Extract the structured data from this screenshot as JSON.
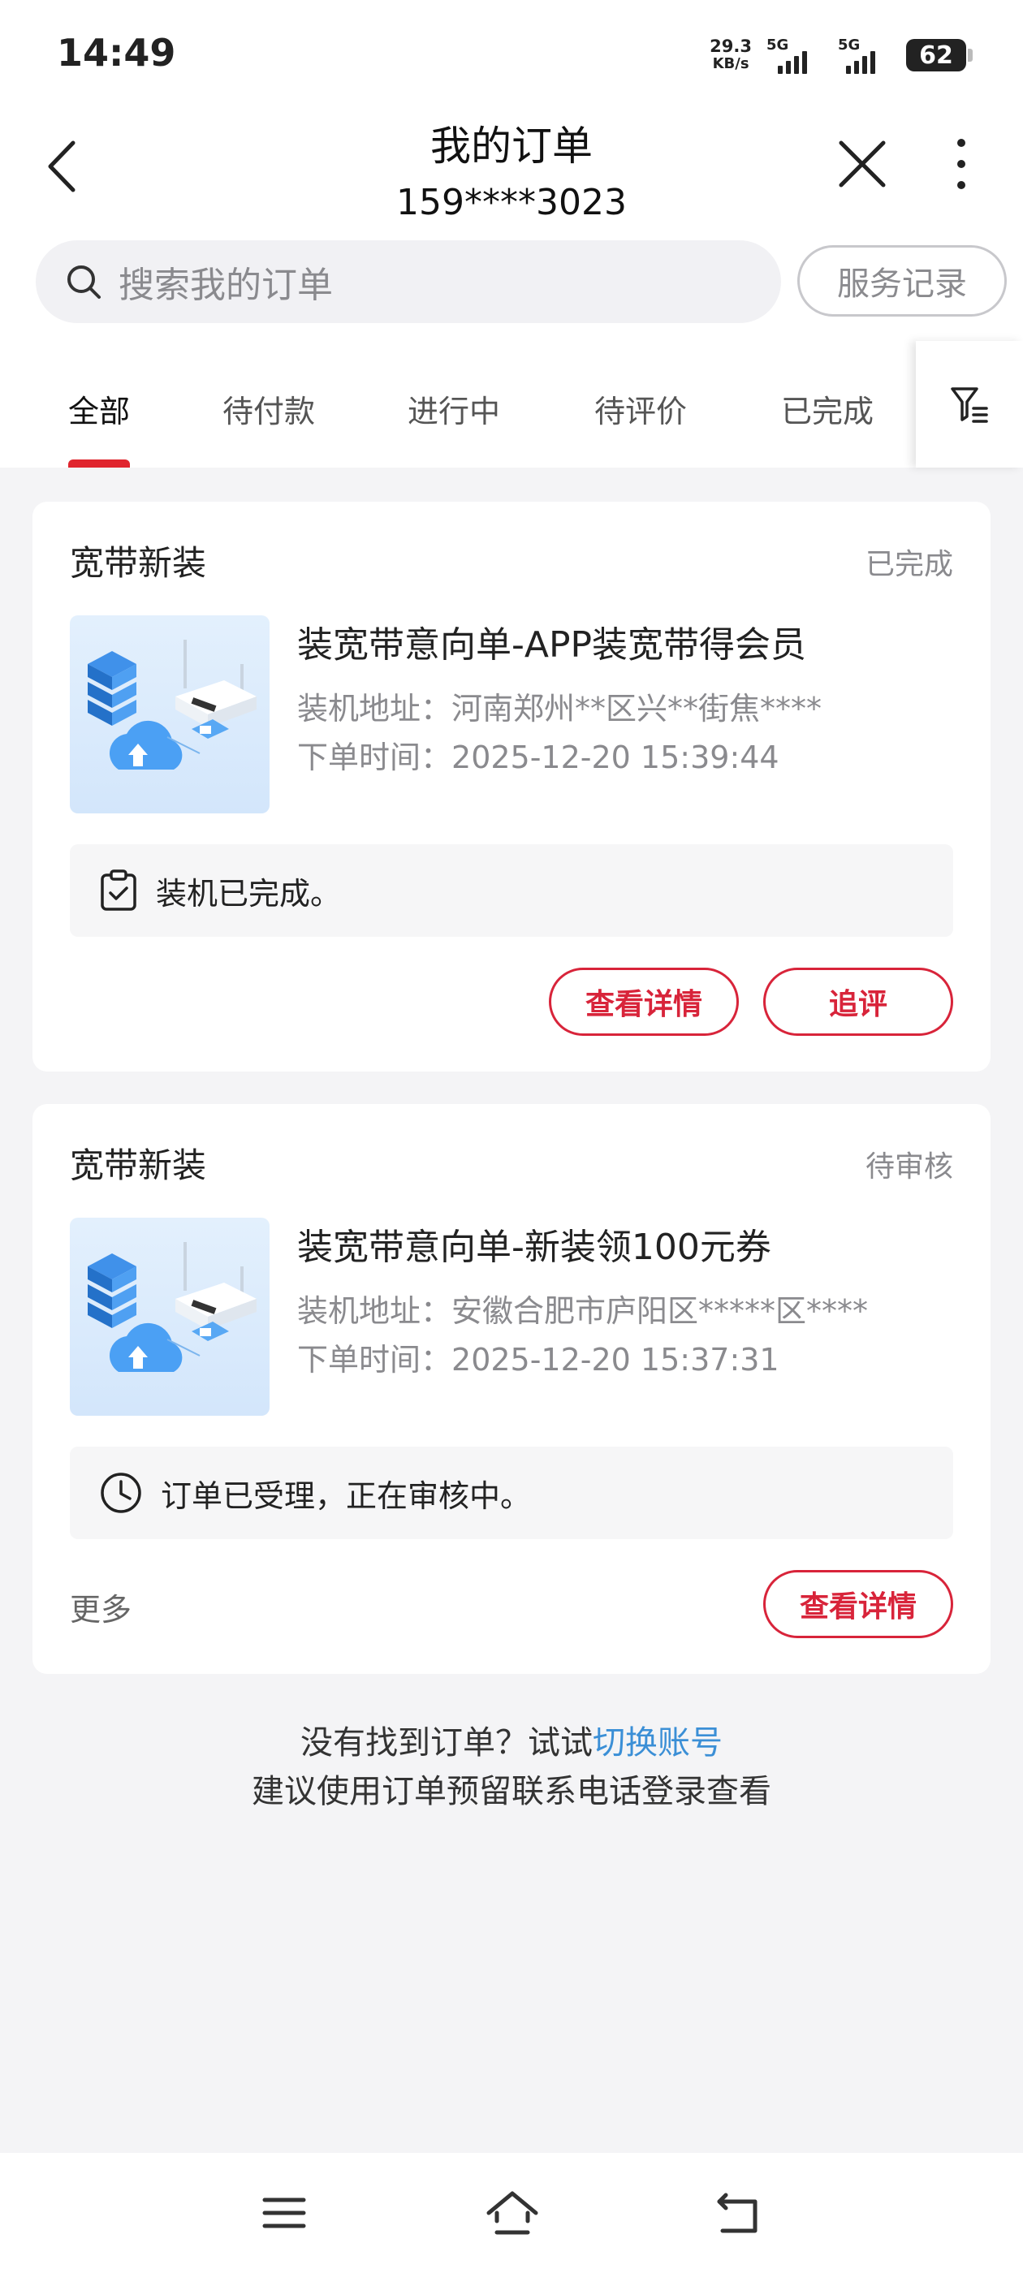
{
  "status_bar": {
    "time": "14:49",
    "net_speed": "29.3",
    "net_unit": "KB/s",
    "sim1": "5G",
    "sim2": "5G",
    "battery": "62"
  },
  "header": {
    "title": "我的订单",
    "phone": "159****3023"
  },
  "search": {
    "placeholder": "搜索我的订单",
    "service_button": "服务记录"
  },
  "tabs": [
    {
      "label": "全部",
      "active": true
    },
    {
      "label": "待付款"
    },
    {
      "label": "进行中"
    },
    {
      "label": "待评价"
    },
    {
      "label": "已完成"
    }
  ],
  "orders": [
    {
      "type": "宽带新装",
      "status": "已完成",
      "product": "装宽带意向单-APP装宽带得会员",
      "address_label": "装机地址：",
      "address": "河南郑州**区兴**街焦****",
      "time_label": "下单时间：",
      "time": "2025-12-20 15:39:44",
      "note": "装机已完成。",
      "buttons": [
        "查看详情",
        "追评"
      ]
    },
    {
      "type": "宽带新装",
      "status": "待审核",
      "product": "装宽带意向单-新装领100元券",
      "address_label": "装机地址：",
      "address": "安徽合肥市庐阳区*****区****",
      "time_label": "下单时间：",
      "time": "2025-12-20 15:37:31",
      "note": "订单已受理，正在审核中。",
      "more": "更多",
      "buttons": [
        "查看详情"
      ]
    }
  ],
  "footer": {
    "line1_prefix": "没有找到订单？试试",
    "line1_link": "切换账号",
    "line2": "建议使用订单预留联系电话登录查看"
  },
  "colors": {
    "accent": "#d8243a",
    "tab_indicator": "#e0252e",
    "link": "#3b8fd6",
    "background": "#f4f4f6"
  }
}
